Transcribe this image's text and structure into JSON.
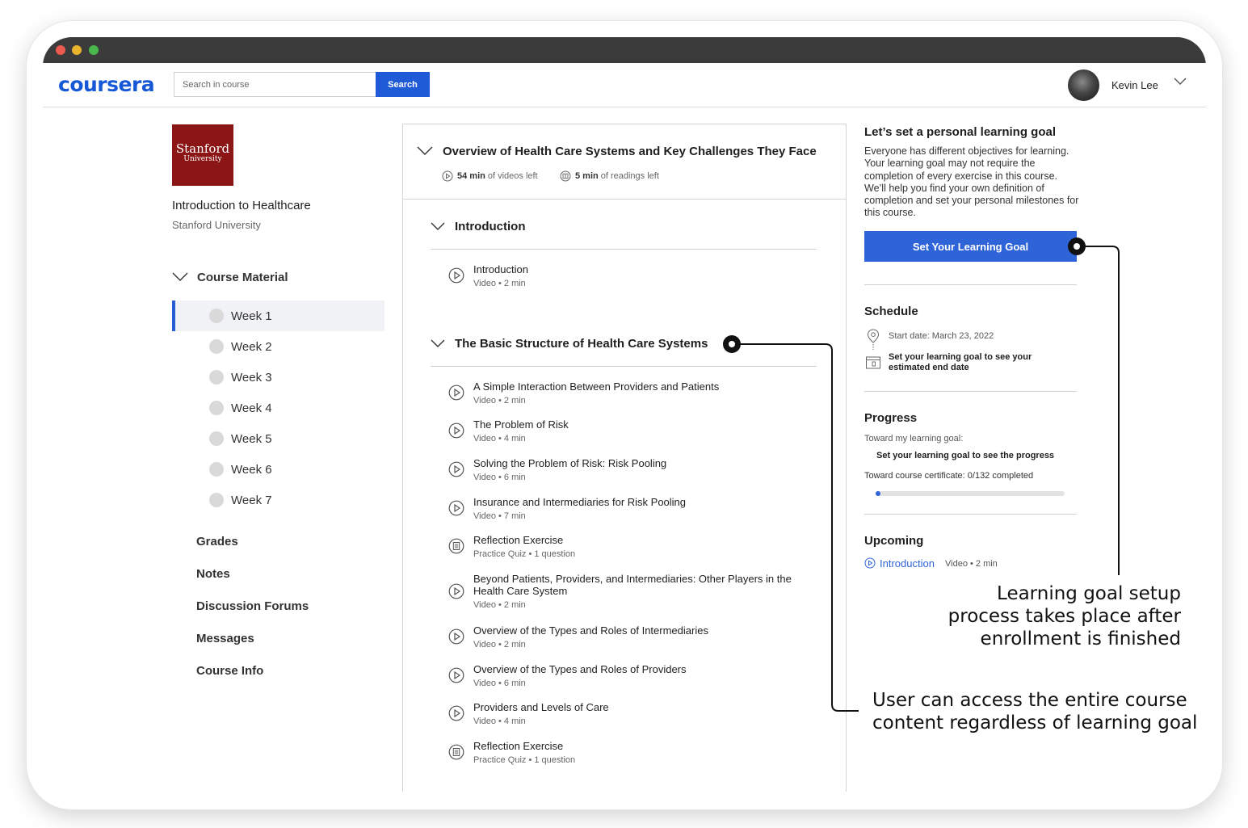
{
  "app": {
    "logo": "coursera"
  },
  "search": {
    "placeholder": "Search in course",
    "button": "Search"
  },
  "user": {
    "name": "Kevin Lee"
  },
  "course": {
    "logo_line1": "Stanford",
    "logo_line2": "University",
    "title": "Introduction to Healthcare",
    "org": "Stanford University"
  },
  "sidebar": {
    "course_material": "Course Material",
    "weeks": [
      "Week 1",
      "Week 2",
      "Week 3",
      "Week 4",
      "Week 5",
      "Week 6",
      "Week 7"
    ],
    "active_week": "Week 1",
    "links": [
      "Grades",
      "Notes",
      "Discussion Forums",
      "Messages",
      "Course Info"
    ]
  },
  "module": {
    "title": "Overview of Health Care Systems and Key Challenges They Face",
    "videos_left_value": "54 min",
    "videos_left_suffix": "of videos left",
    "readings_left_value": "5 min",
    "readings_left_suffix": "of readings left",
    "sections": [
      {
        "title": "Introduction",
        "items": [
          {
            "title": "Introduction",
            "meta": "Video • 2 min",
            "icon": "play-icon"
          }
        ]
      },
      {
        "title": "The Basic Structure of Health Care Systems",
        "items": [
          {
            "title": "A Simple Interaction Between Providers and Patients",
            "meta": "Video • 2 min",
            "icon": "play-icon"
          },
          {
            "title": "The Problem of Risk",
            "meta": "Video • 4 min",
            "icon": "play-icon"
          },
          {
            "title": "Solving the Problem of Risk: Risk Pooling",
            "meta": "Video • 6 min",
            "icon": "play-icon"
          },
          {
            "title": "Insurance and Intermediaries for Risk Pooling",
            "meta": "Video • 7 min",
            "icon": "play-icon"
          },
          {
            "title": "Reflection Exercise",
            "meta": "Practice Quiz • 1 question",
            "icon": "quiz-icon"
          },
          {
            "title": "Beyond Patients, Providers, and Intermediaries: Other Players in the Health Care System",
            "meta": "Video • 2 min",
            "icon": "play-icon"
          },
          {
            "title": "Overview of the Types and Roles of Intermediaries",
            "meta": "Video • 2 min",
            "icon": "play-icon"
          },
          {
            "title": "Overview of the Types and Roles of Providers",
            "meta": "Video • 6 min",
            "icon": "play-icon"
          },
          {
            "title": "Providers and Levels of Care",
            "meta": "Video • 4 min",
            "icon": "play-icon"
          },
          {
            "title": "Reflection Exercise",
            "meta": "Practice Quiz • 1 question",
            "icon": "quiz-icon"
          }
        ]
      }
    ]
  },
  "goal": {
    "heading": "Let’s set a personal learning goal",
    "description": "Everyone has different objectives for learning. Your learning goal may not require the completion of every exercise in this course. We’ll help you find your own definition of completion and set your personal milestones for this course.",
    "button": "Set Your Learning Goal"
  },
  "schedule": {
    "heading": "Schedule",
    "start_date": "Start date: March 23, 2022",
    "end_date_line1": "Set your learning goal to see your",
    "end_date_line2": "estimated end date"
  },
  "progress": {
    "heading": "Progress",
    "toward_goal": "Toward my learning goal:",
    "goal_message": "Set your learning goal to see the progress",
    "toward_certificate": "Toward course certificate: 0/132 completed",
    "completed": 0,
    "total": 132
  },
  "upcoming": {
    "heading": "Upcoming",
    "item_title": "Introduction",
    "item_meta": "Video • 2 min"
  },
  "annotations": {
    "goal_setup": [
      "Learning goal setup",
      "process takes place after",
      "enrollment is finished"
    ],
    "access": [
      "User can access the entire course",
      "content regardless of learning goal"
    ]
  },
  "colors": {
    "brand": "#1658d6",
    "button": "#2f63d8",
    "stanford": "#8c1515",
    "titlebar": "#3b3b3b"
  }
}
